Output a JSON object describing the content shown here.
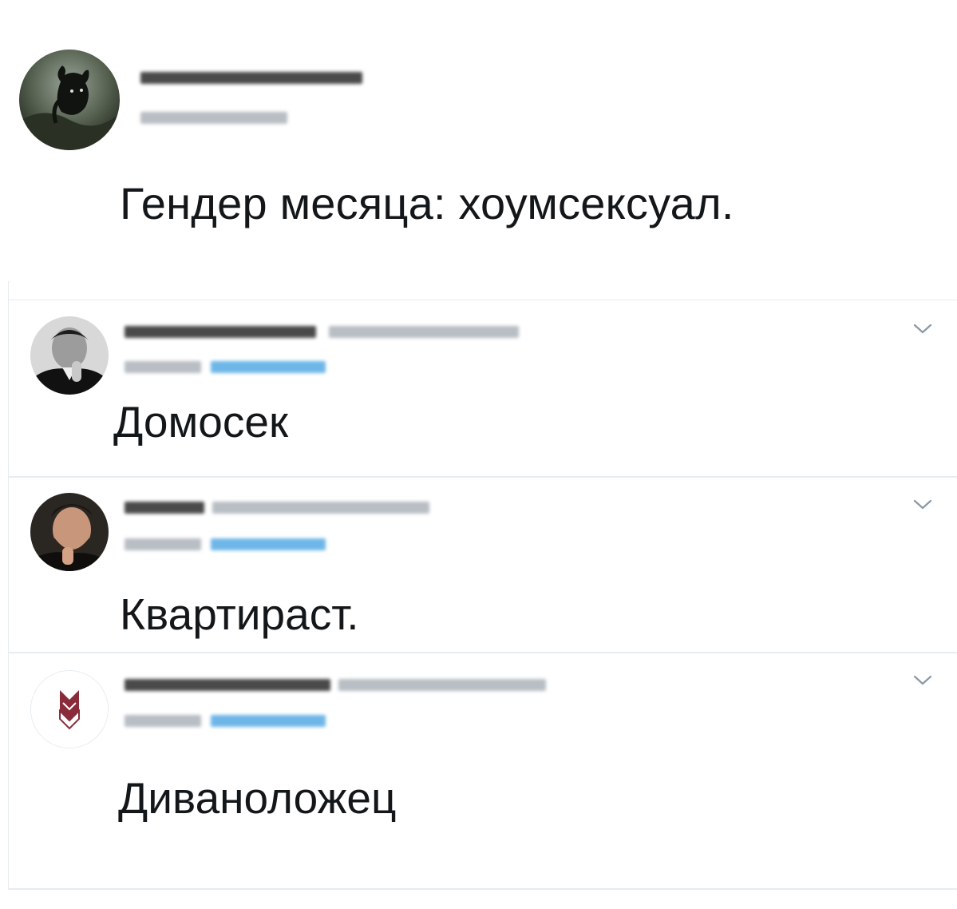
{
  "tweet": {
    "text": "Гендер месяца: хоумсексуал."
  },
  "replies": [
    {
      "text": "Домосек"
    },
    {
      "text": "Квартираст."
    },
    {
      "text": "Диваноложец"
    }
  ],
  "icons": {
    "reply_menu": "chevron-down-icon",
    "avatar": "avatar"
  },
  "colors": {
    "text": "#14171a",
    "blurred_name": "#4a4a4a",
    "blurred_meta": "#b8bec4",
    "blurred_link": "#6fb6e8",
    "divider": "#e6ecf0",
    "chevron": "#8899a6",
    "logo": "#8a2b3a"
  }
}
